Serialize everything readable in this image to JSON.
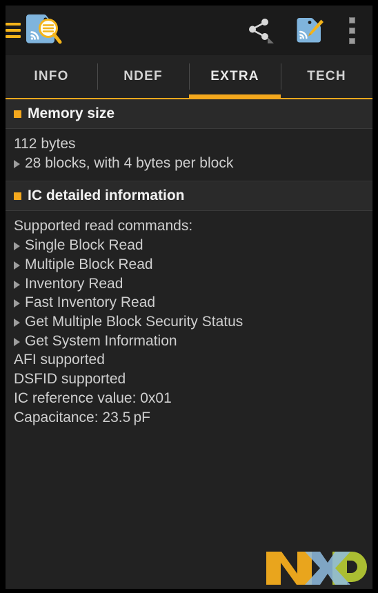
{
  "app": {
    "icon_name": "nfc-tag-reader-icon",
    "drawer_label": "menu-drawer"
  },
  "actionbar": {
    "menu_label": "Open navigation drawer",
    "share_label": "Share",
    "write_label": "Write tag",
    "overflow_label": "More options"
  },
  "tabs": [
    {
      "label": "INFO",
      "active": false
    },
    {
      "label": "NDEF",
      "active": false
    },
    {
      "label": "EXTRA",
      "active": true
    },
    {
      "label": "TECH",
      "active": false
    }
  ],
  "sections": [
    {
      "title": "Memory size",
      "rows": [
        {
          "marker": "none",
          "text": "112 bytes"
        },
        {
          "marker": "triangle",
          "text": "28 blocks, with 4 bytes per block"
        }
      ]
    },
    {
      "title": "IC detailed information",
      "rows": [
        {
          "marker": "none",
          "text": "Supported read commands:"
        },
        {
          "marker": "triangle",
          "text": "Single Block Read"
        },
        {
          "marker": "triangle",
          "text": "Multiple Block Read"
        },
        {
          "marker": "triangle",
          "text": "Inventory Read"
        },
        {
          "marker": "triangle",
          "text": "Fast Inventory Read"
        },
        {
          "marker": "triangle",
          "text": "Get Multiple Block Security Status"
        },
        {
          "marker": "triangle",
          "text": "Get System Information"
        },
        {
          "marker": "none",
          "text": "AFI supported"
        },
        {
          "marker": "none",
          "text": "DSFID supported"
        },
        {
          "marker": "none",
          "text": "IC reference value: 0x01"
        },
        {
          "marker": "none",
          "text": "Capacitance: 23.5 pF"
        }
      ]
    }
  ],
  "footer": {
    "logo_name": "nxp-logo",
    "logo_text": "NXP"
  },
  "colors": {
    "accent": "#f4a81d",
    "window_bg": "#000000",
    "screen_bg": "#222222",
    "actionbar_bg": "#1b1b1b",
    "section_header_bg": "#2a2a2a",
    "text_primary": "#f2f2f2",
    "text_body": "#cfcfcf",
    "tag_blue": "#7fb4dd",
    "logo_orange": "#e9a51d",
    "logo_blue": "#8fbce0",
    "logo_green": "#b7cc34"
  }
}
